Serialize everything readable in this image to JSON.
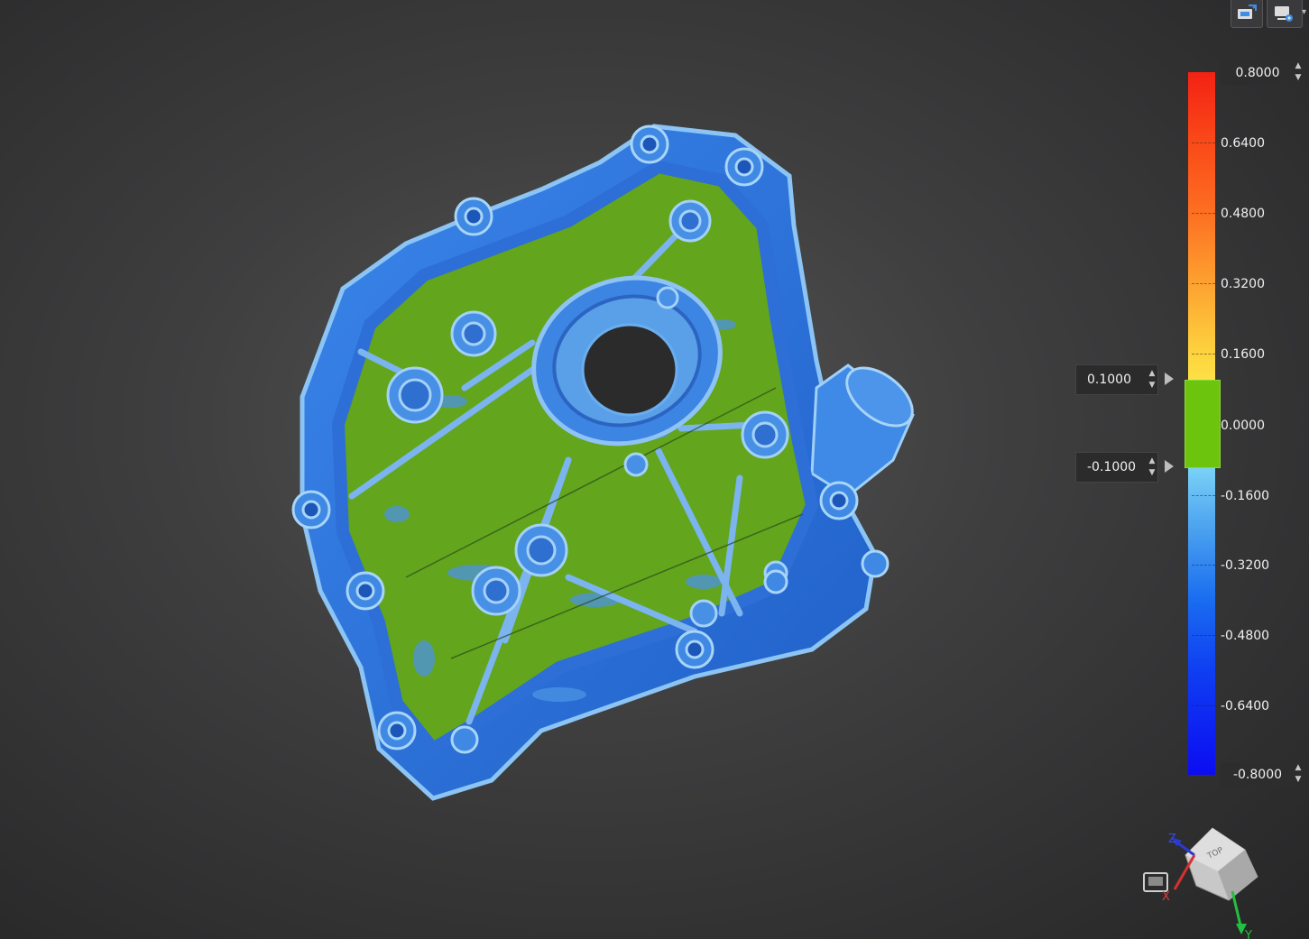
{
  "toolbar": {
    "icons": [
      "swap-view-icon",
      "display-settings-icon"
    ]
  },
  "legend": {
    "max_value": "0.8000",
    "min_value": "-0.8000",
    "ticks": [
      "0.6400",
      "0.4800",
      "0.3200",
      "0.1600",
      "0.0000",
      "-0.1600",
      "-0.3200",
      "-0.4800",
      "-0.6400"
    ],
    "upper_tolerance": "0.1000",
    "lower_tolerance": "-0.1000",
    "colors": {
      "max": "#f32214",
      "tolerance": "#6cc40c",
      "min": "#0c0cf2"
    }
  },
  "navcube": {
    "axes": [
      "Z",
      "X",
      "Y"
    ],
    "face_label": "TOP"
  },
  "model": {
    "icon": "engine-cover-deviation-map",
    "colors": {
      "in_tolerance": "#64a81e",
      "negative": "#2e70d8",
      "edge": "#7fb8f0"
    }
  }
}
